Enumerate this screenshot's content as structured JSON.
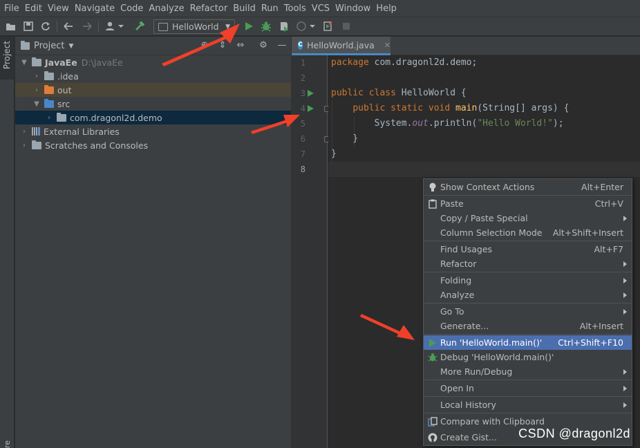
{
  "menubar": [
    "File",
    "Edit",
    "View",
    "Navigate",
    "Code",
    "Analyze",
    "Refactor",
    "Build",
    "Run",
    "Tools",
    "VCS",
    "Window",
    "Help"
  ],
  "toolbar": {
    "run_config": "HelloWorld",
    "icons": [
      "open-icon",
      "save-icon",
      "sync-icon",
      "back-icon",
      "forward-icon",
      "vcs-user-icon",
      "build-icon",
      "run-icon",
      "debug-icon",
      "coverage-icon",
      "profile-icon",
      "attach-icon",
      "stop-icon"
    ]
  },
  "left_stripe": {
    "project_tab": "Project",
    "bottom_tab": "re"
  },
  "project_panel": {
    "title": "Project",
    "tree": [
      {
        "label": "JavaEe",
        "hint": "D:\\JavaEe",
        "expanded": true
      },
      {
        "label": ".idea"
      },
      {
        "label": "out"
      },
      {
        "label": "src",
        "expanded": true
      },
      {
        "label": "com.dragonl2d.demo"
      },
      {
        "label": "External Libraries"
      },
      {
        "label": "Scratches and Consoles"
      }
    ]
  },
  "editor": {
    "tab_label": "HelloWorld.java",
    "tab_badge": "C",
    "line_numbers": [
      "1",
      "2",
      "3",
      "4",
      "5",
      "6",
      "7",
      "8"
    ],
    "code": {
      "l1_kw": "package",
      "l1_rest": " com.dragonl2d.demo;",
      "l3_kw": "public class",
      "l3_rest": " HelloWorld {",
      "l4_indent": "    ",
      "l4_kw": "public static void",
      "l4_fn": "main",
      "l4_rest": "(String[] args) {",
      "l5_pre": "        System.",
      "l5_field": "out",
      "l5_mid": ".println(",
      "l5_str": "\"Hello World!\"",
      "l5_end": ");",
      "l6": "    }",
      "l7": "}"
    }
  },
  "context_menu": [
    {
      "label": "Show Context Actions",
      "shortcut": "Alt+Enter",
      "icon": "bulb-icon"
    },
    {
      "label": "Paste",
      "shortcut": "Ctrl+V",
      "icon": "paste-icon"
    },
    {
      "label": "Copy / Paste Special",
      "submenu": true
    },
    {
      "label": "Column Selection Mode",
      "shortcut": "Alt+Shift+Insert"
    },
    {
      "label": "Find Usages",
      "shortcut": "Alt+F7"
    },
    {
      "label": "Refactor",
      "submenu": true
    },
    {
      "label": "Folding",
      "submenu": true
    },
    {
      "label": "Analyze",
      "submenu": true
    },
    {
      "label": "Go To",
      "submenu": true
    },
    {
      "label": "Generate...",
      "shortcut": "Alt+Insert"
    },
    {
      "label": "Run 'HelloWorld.main()'",
      "shortcut": "Ctrl+Shift+F10",
      "icon": "run-icon",
      "highlighted": true
    },
    {
      "label": "Debug 'HelloWorld.main()'",
      "icon": "debug-icon"
    },
    {
      "label": "More Run/Debug",
      "submenu": true
    },
    {
      "label": "Open In",
      "submenu": true
    },
    {
      "label": "Local History",
      "submenu": true
    },
    {
      "label": "Compare with Clipboard",
      "icon": "compare-icon"
    },
    {
      "label": "Create Gist...",
      "icon": "github-icon"
    }
  ],
  "watermark": "CSDN @dragonl2d",
  "colors": {
    "accent": "#4b6eaf",
    "run_green": "#499c54",
    "keyword": "#cc7832",
    "string": "#6a8759",
    "arrow": "#f0402a"
  }
}
